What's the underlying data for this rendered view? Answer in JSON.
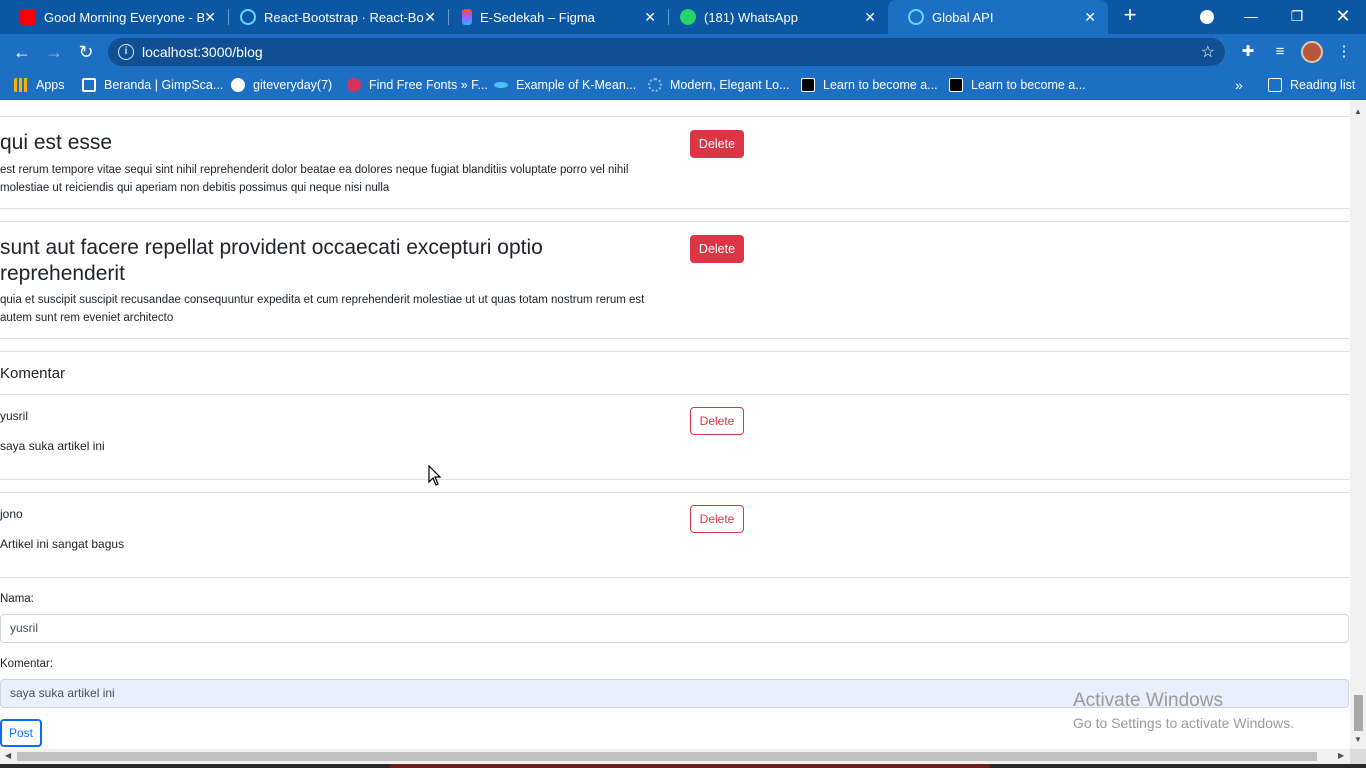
{
  "browser": {
    "tabs": [
      {
        "title": "Good Morning Everyone - Bu",
        "favicon": "youtube-icon",
        "color": "#ff0000",
        "active": false
      },
      {
        "title": "React-Bootstrap · React-Boot",
        "favicon": "react-icon",
        "color": "#61dafb",
        "active": false
      },
      {
        "title": "E-Sedekah – Figma",
        "favicon": "figma-icon",
        "color": "#f24e1e",
        "active": false
      },
      {
        "title": "(181) WhatsApp",
        "favicon": "whatsapp-icon",
        "color": "#25d366",
        "active": false
      },
      {
        "title": "Global API",
        "favicon": "react-icon",
        "color": "#61dafb",
        "active": true
      }
    ],
    "url": "localhost:3000/blog",
    "bookmarks": [
      {
        "label": "Apps",
        "icon": "apps-grid-icon",
        "color": "#f4b400"
      },
      {
        "label": "Beranda | GimpSca...",
        "icon": "gimpscape-icon",
        "color": "#ffffff"
      },
      {
        "label": "giteveryday(7)",
        "icon": "globe-icon",
        "color": "#ffffff"
      },
      {
        "label": "Find Free Fonts » F...",
        "icon": "fonts-icon",
        "color": "#d6335c"
      },
      {
        "label": "Example of K-Mean...",
        "icon": "fish-icon",
        "color": "#4fc3f7"
      },
      {
        "label": "Modern, Elegant Lo...",
        "icon": "logo-icon",
        "color": "#8fb8e8"
      },
      {
        "label": "Learn to become a...",
        "icon": "learn-icon",
        "color": "#000000"
      },
      {
        "label": "Learn to become a...",
        "icon": "learn-icon",
        "color": "#000000"
      }
    ],
    "reading_list": "Reading list"
  },
  "posts": [
    {
      "title": "qui est esse",
      "body": "est rerum tempore vitae sequi sint nihil reprehenderit dolor beatae ea dolores neque fugiat blanditiis voluptate porro vel nihil molestiae ut reiciendis qui aperiam non debitis possimus qui neque nisi nulla",
      "delete_label": "Delete"
    },
    {
      "title": "sunt aut facere repellat provident occaecati excepturi optio reprehenderit",
      "body": "quia et suscipit suscipit recusandae consequuntur expedita et cum reprehenderit molestiae ut ut quas totam nostrum rerum est autem sunt rem eveniet architecto",
      "delete_label": "Delete"
    }
  ],
  "comments_section": {
    "title": "Komentar",
    "comments": [
      {
        "name": "yusril",
        "text": "saya suka artikel ini",
        "delete_label": "Delete"
      },
      {
        "name": "jono",
        "text": "Artikel ini sangat bagus",
        "delete_label": "Delete"
      }
    ]
  },
  "form": {
    "name_label": "Nama:",
    "name_value": "yusril",
    "comment_label": "Komentar:",
    "comment_value": "saya suka artikel ini",
    "submit_label": "Post"
  },
  "watermark": {
    "line1": "Activate Windows",
    "line2": "Go to Settings to activate Windows."
  },
  "colors": {
    "chrome_blue": "#1d6fc4",
    "danger": "#dc3545",
    "primary": "#0d6efd"
  }
}
